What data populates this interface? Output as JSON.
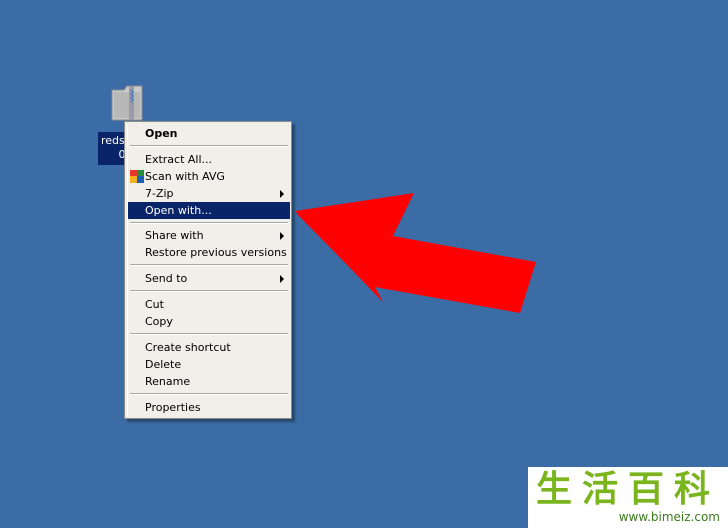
{
  "desktop": {
    "background": "#3b6ca6",
    "icon": {
      "name": "zip-folder-icon",
      "label_line1": "redsn",
      "label_line2": "0.",
      "selection_color": "#0a246a"
    }
  },
  "context_menu": {
    "highlight_color": "#0a246a",
    "items": [
      {
        "label": "Open",
        "bold": true
      },
      {
        "label": "Extract All..."
      },
      {
        "label": "Scan with AVG",
        "icon": "avg-icon"
      },
      {
        "label": "7-Zip",
        "submenu": true
      },
      {
        "label": "Open with...",
        "highlighted": true
      },
      {
        "label": "Share with",
        "submenu": true
      },
      {
        "label": "Restore previous versions"
      },
      {
        "label": "Send to",
        "submenu": true
      },
      {
        "label": "Cut"
      },
      {
        "label": "Copy"
      },
      {
        "label": "Create shortcut"
      },
      {
        "label": "Delete"
      },
      {
        "label": "Rename"
      },
      {
        "label": "Properties"
      }
    ]
  },
  "annotation": {
    "arrow_color": "#ff0000",
    "arrow_target": "Open with..."
  },
  "watermark": {
    "chars": "生活百科",
    "url": "www.bimeiz.com"
  }
}
